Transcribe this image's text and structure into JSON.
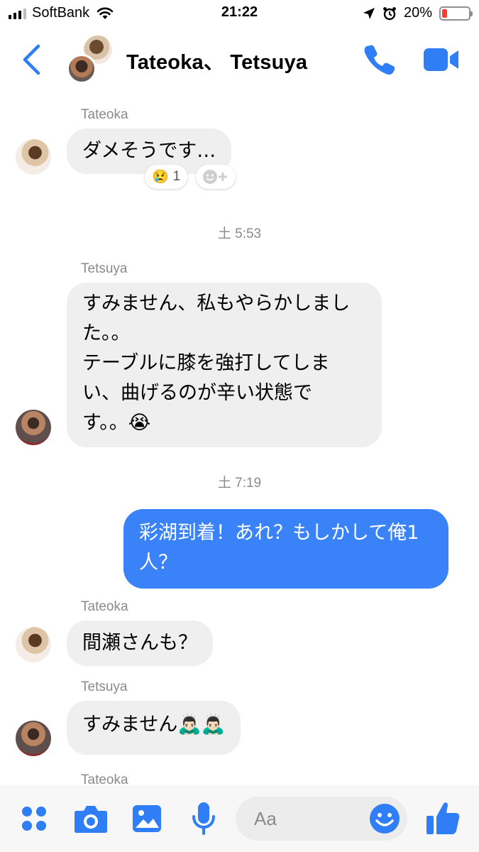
{
  "status_bar": {
    "carrier": "SoftBank",
    "time": "21:22",
    "battery_percent": "20%",
    "battery_level": 0.2,
    "icons": [
      "signal-icon",
      "wifi-icon",
      "location-icon",
      "alarm-icon",
      "battery-icon"
    ]
  },
  "header": {
    "title": "Tateoka、 Tetsuya",
    "icons": [
      "back-chevron-icon",
      "phone-icon",
      "video-camera-icon"
    ],
    "accent_color": "#2f7ef5"
  },
  "messages": [
    {
      "type": "incoming",
      "sender": "Tateoka",
      "text": "ダメそうです…",
      "reaction": {
        "emoji": "😢",
        "count": "1"
      }
    },
    {
      "type": "timestamp",
      "text": "土 5:53"
    },
    {
      "type": "incoming",
      "sender": "Tetsuya",
      "lines": [
        "すみません、私もやらかしまし",
        "た。。",
        "テーブルに膝を強打してしま",
        "い、曲げるのが辛い状態で",
        "す。。😭"
      ]
    },
    {
      "type": "timestamp",
      "text": "土 7:19"
    },
    {
      "type": "outgoing",
      "lines": [
        "彩湖到着！あれ？もしかして俺1",
        "人？"
      ]
    },
    {
      "type": "incoming",
      "sender": "Tateoka",
      "text": "間瀬さんも？"
    },
    {
      "type": "incoming",
      "sender": "Tetsuya",
      "text": "すみません🙇🏻‍♂️🙇🏻‍♂️"
    },
    {
      "type": "sender_only",
      "sender": "Tateoka"
    }
  ],
  "composer": {
    "placeholder": "Aa",
    "icons": [
      "apps-grid-icon",
      "camera-icon",
      "photo-icon",
      "microphone-icon",
      "emoji-icon",
      "thumbs-up-icon"
    ]
  },
  "colors": {
    "outgoing_bubble": "#3a82f7",
    "incoming_bubble": "#efefef",
    "meta_text": "#8a8a8a"
  }
}
